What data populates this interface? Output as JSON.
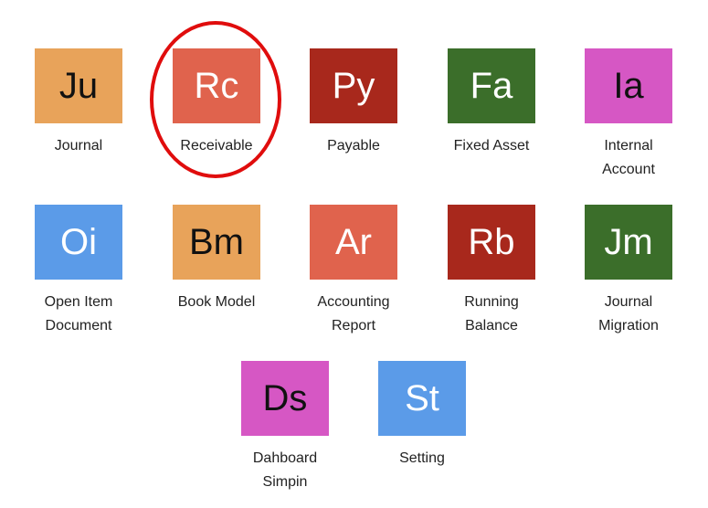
{
  "apps": [
    {
      "abbr": "Ju",
      "label": "Journal",
      "color": "#e8a35a",
      "text_color": "#111111"
    },
    {
      "abbr": "Rc",
      "label": "Receivable",
      "color": "#e0634d",
      "text_color": "#ffffff"
    },
    {
      "abbr": "Py",
      "label": "Payable",
      "color": "#a8281c",
      "text_color": "#ffffff"
    },
    {
      "abbr": "Fa",
      "label": "Fixed Asset",
      "color": "#3b6e2a",
      "text_color": "#ffffff"
    },
    {
      "abbr": "Ia",
      "label": "Internal\nAccount",
      "color": "#d657c4",
      "text_color": "#111111"
    },
    {
      "abbr": "Oi",
      "label": "Open Item\nDocument",
      "color": "#5b9be8",
      "text_color": "#ffffff"
    },
    {
      "abbr": "Bm",
      "label": "Book Model",
      "color": "#e8a35a",
      "text_color": "#111111"
    },
    {
      "abbr": "Ar",
      "label": "Accounting\nReport",
      "color": "#e0634d",
      "text_color": "#ffffff"
    },
    {
      "abbr": "Rb",
      "label": "Running\nBalance",
      "color": "#a8281c",
      "text_color": "#ffffff"
    },
    {
      "abbr": "Jm",
      "label": "Journal\nMigration",
      "color": "#3b6e2a",
      "text_color": "#ffffff"
    },
    {
      "abbr": "Ds",
      "label": "Dahboard\nSimpin",
      "color": "#d657c4",
      "text_color": "#111111"
    },
    {
      "abbr": "St",
      "label": "Setting",
      "color": "#5b9be8",
      "text_color": "#ffffff"
    }
  ],
  "highlight_color": "#e00d0d"
}
